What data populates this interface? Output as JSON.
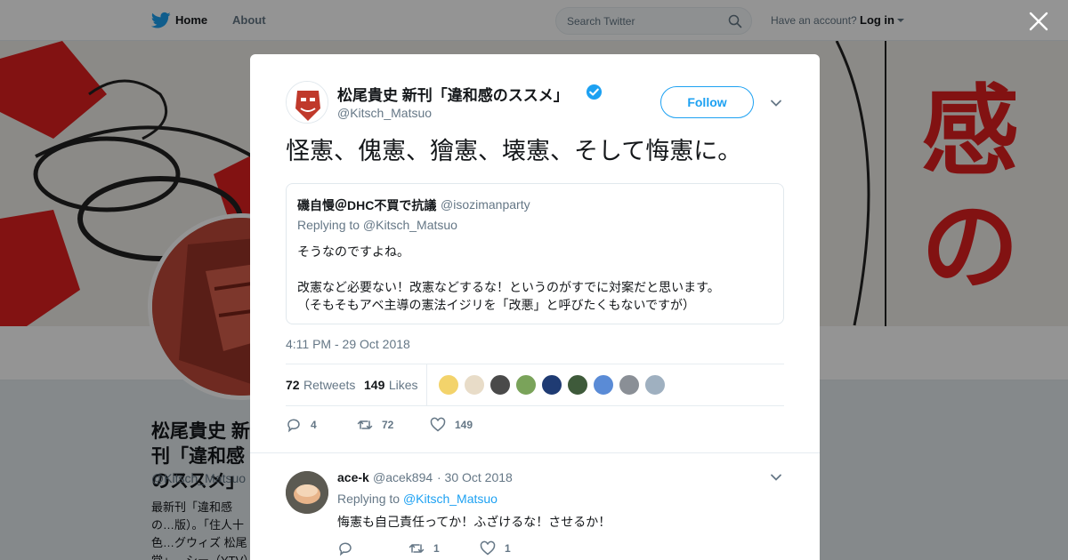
{
  "nav": {
    "home": "Home",
    "about": "About",
    "search_placeholder": "Search Twitter",
    "have_account": "Have an account?",
    "login": "Log in"
  },
  "background_profile": {
    "name": "松尾貴史 新刊「違和感のススメ」",
    "handle": "@Kitsch_Matsuo",
    "bio": "最新刊「違和感の…版）。「住人十色…グウィズ 松尾堂」…シー（YTV）他"
  },
  "tweet": {
    "author_name": "松尾貴史 新刊「違和感のススメ」",
    "author_handle": "@Kitsch_Matsuo",
    "follow_label": "Follow",
    "text": "怪憲、傀憲、獪憲、壊憲、そして悔憲に。",
    "timestamp": "4:11 PM - 29 Oct 2018",
    "retweets_count": "72",
    "retweets_label": "Retweets",
    "likes_count": "149",
    "likes_label": "Likes",
    "reply_count": "4",
    "retweet_count": "72",
    "like_count": "149",
    "liker_colors": [
      "#f3d36b",
      "#e8dcc8",
      "#4a4a4a",
      "#7aa35a",
      "#1f3b73",
      "#3e5a3a",
      "#5a8bd6",
      "#8a8f96",
      "#9fb0c0"
    ]
  },
  "quote": {
    "name": "磯自慢＠DHC不買で抗議",
    "handle": "@isozimanparty",
    "replying_to": "Replying to @Kitsch_Matsuo",
    "text": "そうなのですよね。\n\n改憲など必要ない！改憲などするな！というのがすでに対案だと思います。\n（そもそもアベ主導の憲法イジリを「改悪」と呼びたくもないですが）"
  },
  "reply": {
    "name": "ace-k",
    "handle": "@acek894",
    "date": "· 30 Oct 2018",
    "replying_prefix": "Replying to",
    "replying_handle": "@Kitsch_Matsuo",
    "text": "悔憲も自己責任ってか！ふざけるな！させるか！",
    "retweet_count": "1",
    "like_count": "1"
  },
  "colors": {
    "accent": "#1da1f2",
    "banner_red": "#e02020"
  }
}
